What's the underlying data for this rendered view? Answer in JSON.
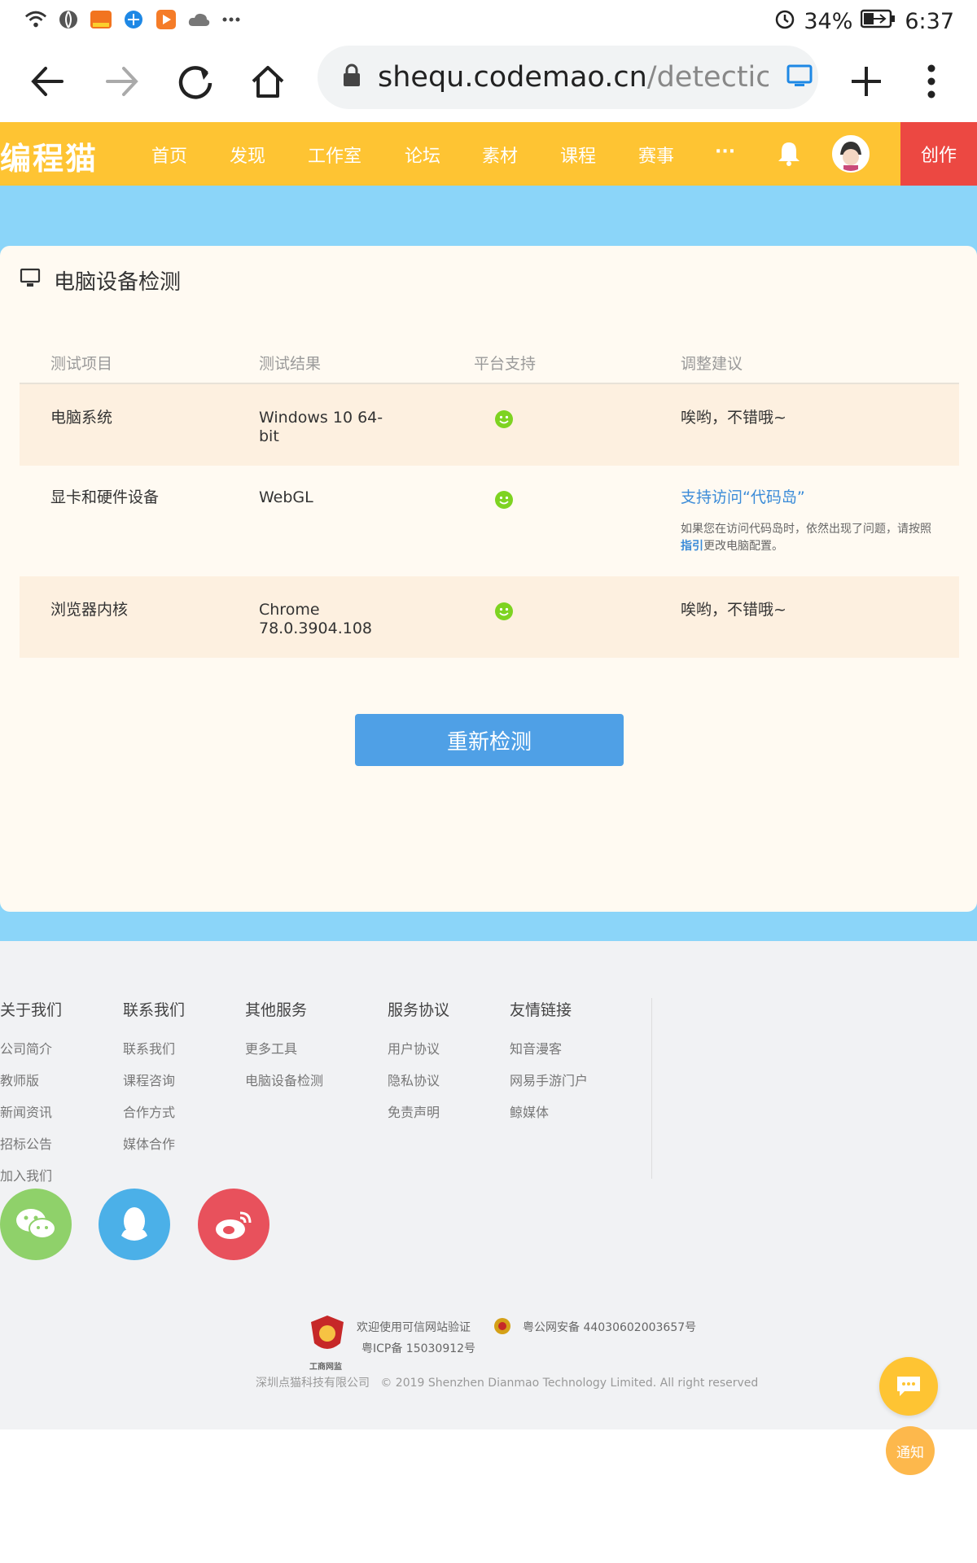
{
  "status_bar": {
    "battery": "34%",
    "time": "6:37",
    "icons": [
      "wifi-icon",
      "globe-icon",
      "app-badge-icon",
      "browser-icon",
      "video-icon",
      "cloud-icon",
      "more-dots-icon",
      "alarm-icon",
      "battery-charging-icon"
    ]
  },
  "browser": {
    "url_host": "shequ.codemao.cn",
    "url_path": "/detectic"
  },
  "site_nav": {
    "logo": "编程猫",
    "items": [
      "首页",
      "发现",
      "工作室",
      "论坛",
      "素材",
      "课程",
      "赛事",
      "···"
    ],
    "create": "创作"
  },
  "detection": {
    "title": "电脑设备检测",
    "headers": [
      "测试项目",
      "测试结果",
      "平台支持",
      "调整建议"
    ],
    "rows": [
      {
        "item": "电脑系统",
        "result_line1": "Windows 10 64-",
        "result_line2": "bit",
        "advice": "唉哟，不错哦~"
      },
      {
        "item": "显卡和硬件设备",
        "result_line1": "WebGL",
        "result_line2": "",
        "advice_link": "支持访问“代码岛”",
        "advice_note_pre": "如果您在访问代码岛时，依然出现了问题，请按照",
        "advice_note_link": "指引",
        "advice_note_post": "更改电脑配置。"
      },
      {
        "item": "浏览器内核",
        "result_line1": "Chrome",
        "result_line2": "78.0.3904.108",
        "advice": "唉哟，不错哦~"
      }
    ],
    "recheck_button": "重新检测",
    "colors": {
      "ok": "#7ed321",
      "link": "#3a8bd8",
      "button": "#4fa0e6"
    }
  },
  "footer": {
    "columns": [
      {
        "head": "关于我们",
        "links": [
          "公司简介",
          "教师版",
          "新闻资讯",
          "招标公告",
          "加入我们"
        ]
      },
      {
        "head": "联系我们",
        "links": [
          "联系我们",
          "课程咨询",
          "合作方式",
          "媒体合作"
        ]
      },
      {
        "head": "其他服务",
        "links": [
          "更多工具",
          "电脑设备检测"
        ]
      },
      {
        "head": "服务协议",
        "links": [
          "用户协议",
          "隐私协议",
          "免责声明"
        ]
      },
      {
        "head": "友情链接",
        "links": [
          "知音漫客",
          "网易手游门户",
          "鲸媒体"
        ]
      }
    ],
    "verify": "欢迎使用可信网站验证",
    "police": "粤公网安备 44030602003657号",
    "icp": "粤ICP备 15030912号",
    "badge_caption": "工商网监",
    "company": "深圳点猫科技有限公司",
    "copyright": "© 2019 Shenzhen Dianmao Technology Limited. All right reserved",
    "notice": "通知"
  }
}
